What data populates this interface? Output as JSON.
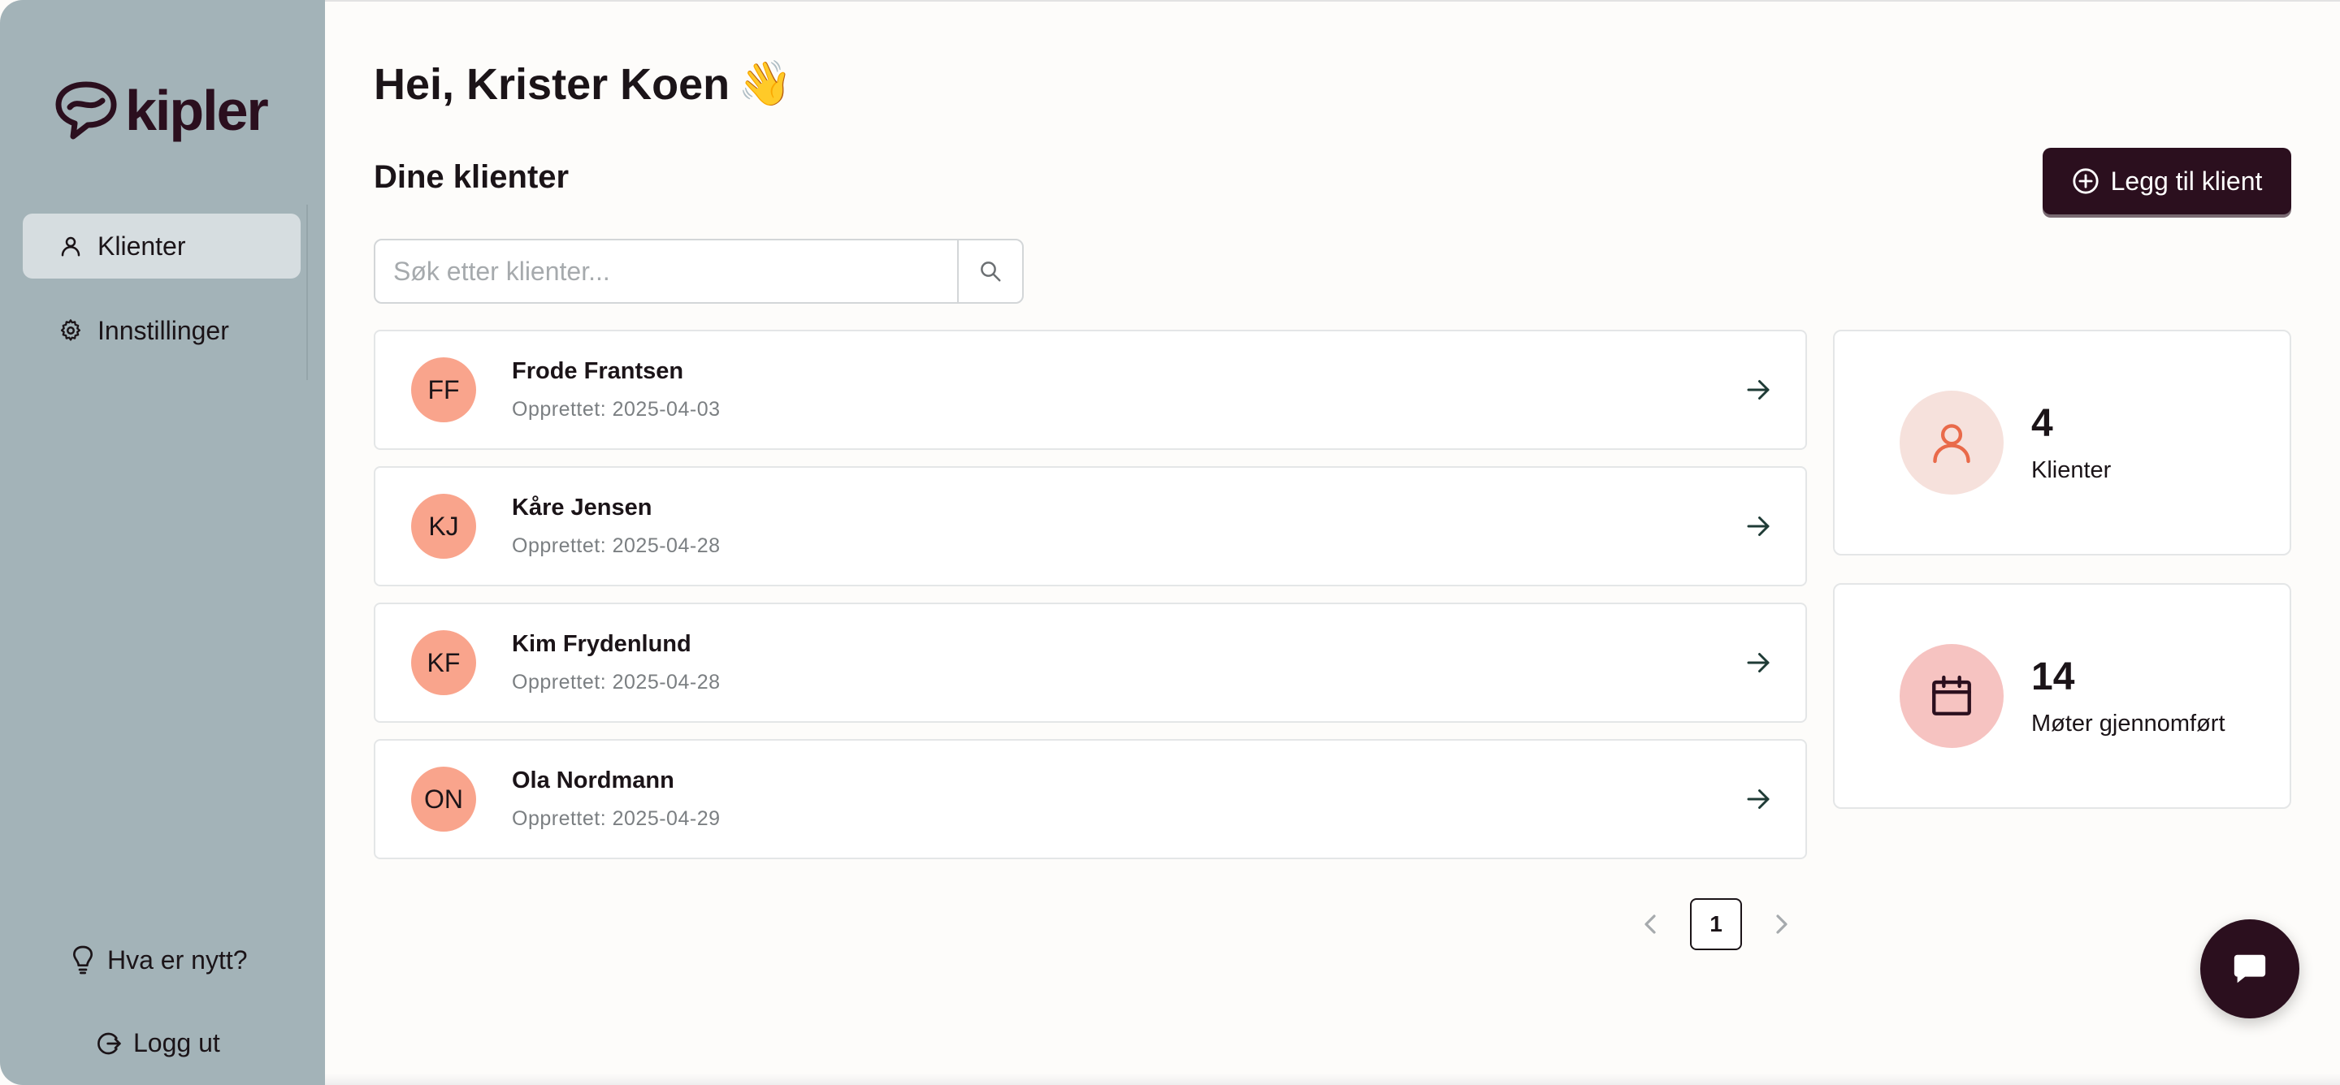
{
  "app": {
    "logo_text": "kipler"
  },
  "sidebar": {
    "items": [
      {
        "label": "Klienter",
        "icon": "user-icon",
        "active": true
      },
      {
        "label": "Innstillinger",
        "icon": "gear-icon",
        "active": false
      }
    ],
    "whats_new": {
      "label": "Hva er nytt?",
      "icon": "lightbulb-icon"
    },
    "logout": {
      "label": "Logg ut",
      "icon": "logout-icon"
    }
  },
  "header": {
    "greeting": "Hei, Krister Koen",
    "emoji": "👋"
  },
  "clients_section": {
    "title": "Dine klienter",
    "add_button": "Legg til klient",
    "search_placeholder": "Søk etter klienter..."
  },
  "clients": [
    {
      "initials": "FF",
      "name": "Frode Frantsen",
      "created": "Opprettet: 2025-04-03"
    },
    {
      "initials": "KJ",
      "name": "Kåre Jensen",
      "created": "Opprettet: 2025-04-28"
    },
    {
      "initials": "KF",
      "name": "Kim Frydenlund",
      "created": "Opprettet: 2025-04-28"
    },
    {
      "initials": "ON",
      "name": "Ola Nordmann",
      "created": "Opprettet: 2025-04-29"
    }
  ],
  "stats": [
    {
      "value": "4",
      "label": "Klienter",
      "icon": "user-icon",
      "color": "#e96a4a",
      "bg": "#f6e1dc"
    },
    {
      "value": "14",
      "label": "Møter gjennomført",
      "icon": "calendar-icon",
      "color": "#2b0f1e",
      "bg": "#f6c3c1"
    }
  ],
  "pagination": {
    "current": "1"
  },
  "colors": {
    "brand": "#2b0f1e",
    "sidebar": "#a3b3b8",
    "avatar": "#f9a48c"
  }
}
